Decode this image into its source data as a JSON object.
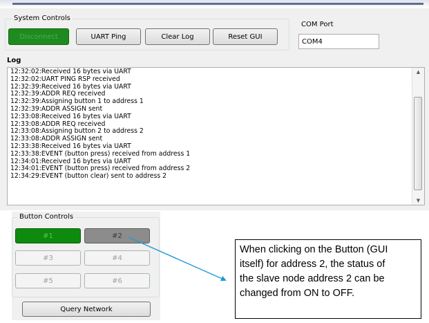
{
  "system_controls": {
    "title": "System Controls",
    "disconnect_label": "Disconnect",
    "uart_ping_label": "UART Ping",
    "clear_log_label": "Clear Log",
    "reset_gui_label": "Reset GUI"
  },
  "com_port": {
    "label": "COM Port",
    "value": "COM4"
  },
  "log": {
    "title": "Log",
    "lines": [
      "12:32:02:Received 16 bytes via UART",
      "12:32:02:UART PING RSP received",
      "12:32:39:Received 16 bytes via UART",
      "12:32:39:ADDR REQ received",
      "12:32:39:Assigning button 1 to address 1",
      "12:32:39:ADDR ASSIGN sent",
      "12:33:08:Received 16 bytes via UART",
      "12:33:08:ADDR REQ received",
      "12:33:08:Assigning button 2 to address 2",
      "12:33:08:ADDR ASSIGN sent",
      "12:33:38:Received 16 bytes via UART",
      "12:33:38:EVENT (button press) received from address 1",
      "12:34:01:Received 16 bytes via UART",
      "12:34:01:EVENT (button press) received from address 2",
      "12:34:29:EVENT (button clear) sent to address 2"
    ]
  },
  "button_controls": {
    "title": "Button Controls",
    "buttons": [
      "#1",
      "#2",
      "#3",
      "#4",
      "#5",
      "#6"
    ],
    "query_network_label": "Query Network"
  },
  "annotation": {
    "lines": [
      "When clicking on the Button (GUI",
      "itself) for address 2, the status of",
      "the slave node address 2 can be",
      "changed from ON to OFF."
    ],
    "arrow_color": "#1f9ad6"
  },
  "colors": {
    "connected_green": "#1f8a1f",
    "button_on_green": "#0e8a0e",
    "button_off_gray": "#8c8c8c"
  }
}
